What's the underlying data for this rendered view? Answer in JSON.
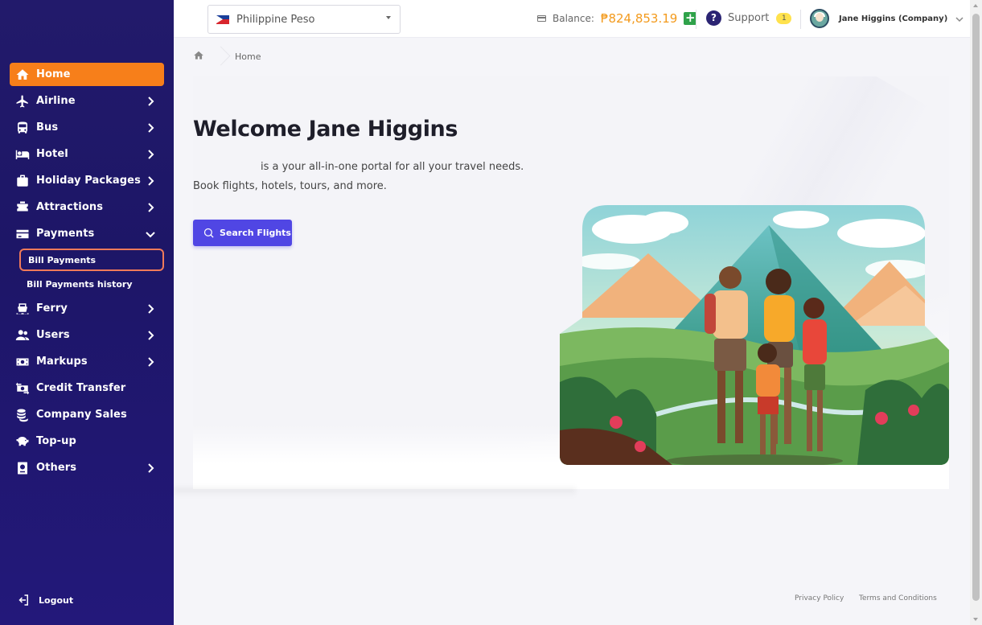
{
  "sidebar": {
    "items": [
      {
        "label": "Home",
        "icon": "home-icon",
        "active": true,
        "chevron": false
      },
      {
        "label": "Airline",
        "icon": "plane-icon",
        "chevron": "right"
      },
      {
        "label": "Bus",
        "icon": "bus-icon",
        "chevron": "right"
      },
      {
        "label": "Hotel",
        "icon": "bed-icon",
        "chevron": "right"
      },
      {
        "label": "Holiday Packages",
        "icon": "suitcase-icon",
        "chevron": "right"
      },
      {
        "label": "Attractions",
        "icon": "ticket-icon",
        "chevron": "right"
      },
      {
        "label": "Payments",
        "icon": "card-icon",
        "chevron": "down"
      },
      {
        "label": "Ferry",
        "icon": "ferry-icon",
        "chevron": "right"
      },
      {
        "label": "Users",
        "icon": "users-icon",
        "chevron": "right"
      },
      {
        "label": "Markups",
        "icon": "money-icon",
        "chevron": "right"
      },
      {
        "label": "Credit Transfer",
        "icon": "transfer-icon",
        "chevron": false
      },
      {
        "label": "Company Sales",
        "icon": "coins-icon",
        "chevron": false
      },
      {
        "label": "Top-up",
        "icon": "piggy-bank-icon",
        "chevron": false
      },
      {
        "label": "Others",
        "icon": "passport-icon",
        "chevron": "right"
      }
    ],
    "payments_sub": [
      "Bill Payments",
      "Bill Payments history"
    ],
    "logout": "Logout"
  },
  "topbar": {
    "currency": "Philippine Peso",
    "balance_label": "Balance:",
    "balance_value": "₱824,853.19",
    "support_label": "Support",
    "support_badge": "1",
    "user_name": "Jane Higgins (Company)"
  },
  "breadcrumb": {
    "current": "Home"
  },
  "hero": {
    "title": "Welcome Jane Higgins",
    "line1": "is a your all-in-one portal for all your travel needs.",
    "line2": "Book flights, hotels, tours, and more.",
    "button": "Search Flights"
  },
  "footer": {
    "privacy": "Privacy Policy",
    "terms": "Terms and Conditions"
  },
  "colors": {
    "sidebar": "#1d1667",
    "accent": "#f77f1a",
    "primary_button": "#5046e4",
    "balance": "#f39a1c"
  }
}
